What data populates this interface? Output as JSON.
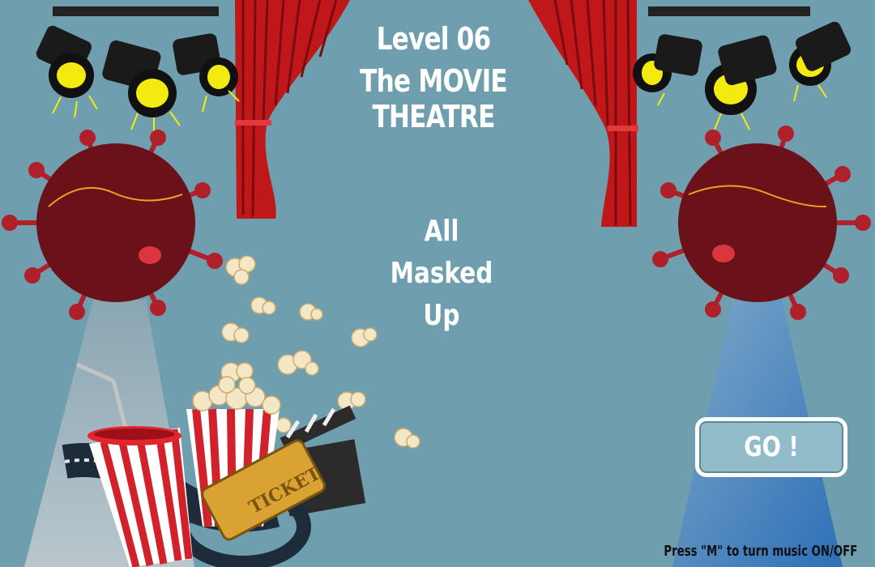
{
  "level": {
    "label": "Level 06",
    "name": "The MOVIE THEATRE",
    "subtitle_lines": [
      "All",
      "Masked",
      "Up"
    ]
  },
  "go_button": {
    "label": "GO !"
  },
  "hint": {
    "music": "Press \"M\" to turn music ON/OFF"
  },
  "colors": {
    "background": "#6f9fae",
    "curtain": "#c0171b",
    "virus": "#6b1119",
    "virus_spike": "#b0202a",
    "button_fill": "#93bccb",
    "text": "#ffffff"
  },
  "icons": [
    "spotlight-icon",
    "curtain-icon",
    "virus-icon",
    "popcorn-icon",
    "soda-cup-icon",
    "movie-ticket-icon",
    "film-reel-icon",
    "clapperboard-icon"
  ]
}
